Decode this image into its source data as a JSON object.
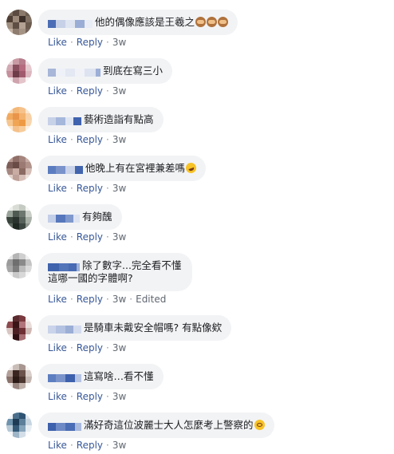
{
  "ui": {
    "like_label": "Like",
    "reply_label": "Reply",
    "sep": "·"
  },
  "comments": [
    {
      "text": "他的偶像應該是王羲之",
      "emoji": [
        "see-no-evil-monkey-emoji",
        "see-no-evil-monkey-emoji",
        "see-no-evil-monkey-emoji"
      ],
      "time": "3w"
    },
    {
      "text": "到底在寫三小",
      "time": "3w"
    },
    {
      "text": "藝術造詣有點高",
      "time": "3w"
    },
    {
      "text": "他晚上有在宮裡兼差嗎",
      "emoji": [
        "rofl-emoji"
      ],
      "time": "3w"
    },
    {
      "text": "有夠醜",
      "time": "3w"
    },
    {
      "text_line1": "除了數字...完全看不懂",
      "text_line2": "這哪一國的字體啊?",
      "time": "3w",
      "edited": "Edited"
    },
    {
      "text": "是騎車未戴安全帽嗎?  有點像欸",
      "time": "3w"
    },
    {
      "text": "這寫啥…看不懂",
      "time": "3w"
    },
    {
      "text": "滿好奇這位波麗士大人怎麼考上警察的",
      "emoji": [
        "woozy-face-emoji"
      ],
      "time": "3w"
    }
  ],
  "colors": {
    "bubble_bg": "#f2f3f5",
    "link": "#385898",
    "meta": "#606770",
    "name_blur": "#4267b2"
  }
}
